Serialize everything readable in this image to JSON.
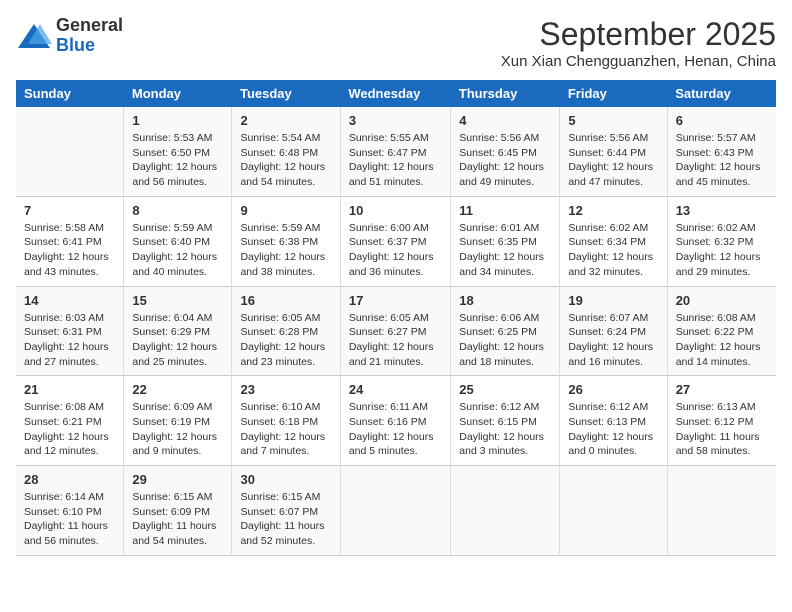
{
  "logo": {
    "line1": "General",
    "line2": "Blue"
  },
  "title": "September 2025",
  "subtitle": "Xun Xian Chengguanzhen, Henan, China",
  "weekdays": [
    "Sunday",
    "Monday",
    "Tuesday",
    "Wednesday",
    "Thursday",
    "Friday",
    "Saturday"
  ],
  "weeks": [
    [
      {
        "day": "",
        "info": ""
      },
      {
        "day": "1",
        "info": "Sunrise: 5:53 AM\nSunset: 6:50 PM\nDaylight: 12 hours\nand 56 minutes."
      },
      {
        "day": "2",
        "info": "Sunrise: 5:54 AM\nSunset: 6:48 PM\nDaylight: 12 hours\nand 54 minutes."
      },
      {
        "day": "3",
        "info": "Sunrise: 5:55 AM\nSunset: 6:47 PM\nDaylight: 12 hours\nand 51 minutes."
      },
      {
        "day": "4",
        "info": "Sunrise: 5:56 AM\nSunset: 6:45 PM\nDaylight: 12 hours\nand 49 minutes."
      },
      {
        "day": "5",
        "info": "Sunrise: 5:56 AM\nSunset: 6:44 PM\nDaylight: 12 hours\nand 47 minutes."
      },
      {
        "day": "6",
        "info": "Sunrise: 5:57 AM\nSunset: 6:43 PM\nDaylight: 12 hours\nand 45 minutes."
      }
    ],
    [
      {
        "day": "7",
        "info": "Sunrise: 5:58 AM\nSunset: 6:41 PM\nDaylight: 12 hours\nand 43 minutes."
      },
      {
        "day": "8",
        "info": "Sunrise: 5:59 AM\nSunset: 6:40 PM\nDaylight: 12 hours\nand 40 minutes."
      },
      {
        "day": "9",
        "info": "Sunrise: 5:59 AM\nSunset: 6:38 PM\nDaylight: 12 hours\nand 38 minutes."
      },
      {
        "day": "10",
        "info": "Sunrise: 6:00 AM\nSunset: 6:37 PM\nDaylight: 12 hours\nand 36 minutes."
      },
      {
        "day": "11",
        "info": "Sunrise: 6:01 AM\nSunset: 6:35 PM\nDaylight: 12 hours\nand 34 minutes."
      },
      {
        "day": "12",
        "info": "Sunrise: 6:02 AM\nSunset: 6:34 PM\nDaylight: 12 hours\nand 32 minutes."
      },
      {
        "day": "13",
        "info": "Sunrise: 6:02 AM\nSunset: 6:32 PM\nDaylight: 12 hours\nand 29 minutes."
      }
    ],
    [
      {
        "day": "14",
        "info": "Sunrise: 6:03 AM\nSunset: 6:31 PM\nDaylight: 12 hours\nand 27 minutes."
      },
      {
        "day": "15",
        "info": "Sunrise: 6:04 AM\nSunset: 6:29 PM\nDaylight: 12 hours\nand 25 minutes."
      },
      {
        "day": "16",
        "info": "Sunrise: 6:05 AM\nSunset: 6:28 PM\nDaylight: 12 hours\nand 23 minutes."
      },
      {
        "day": "17",
        "info": "Sunrise: 6:05 AM\nSunset: 6:27 PM\nDaylight: 12 hours\nand 21 minutes."
      },
      {
        "day": "18",
        "info": "Sunrise: 6:06 AM\nSunset: 6:25 PM\nDaylight: 12 hours\nand 18 minutes."
      },
      {
        "day": "19",
        "info": "Sunrise: 6:07 AM\nSunset: 6:24 PM\nDaylight: 12 hours\nand 16 minutes."
      },
      {
        "day": "20",
        "info": "Sunrise: 6:08 AM\nSunset: 6:22 PM\nDaylight: 12 hours\nand 14 minutes."
      }
    ],
    [
      {
        "day": "21",
        "info": "Sunrise: 6:08 AM\nSunset: 6:21 PM\nDaylight: 12 hours\nand 12 minutes."
      },
      {
        "day": "22",
        "info": "Sunrise: 6:09 AM\nSunset: 6:19 PM\nDaylight: 12 hours\nand 9 minutes."
      },
      {
        "day": "23",
        "info": "Sunrise: 6:10 AM\nSunset: 6:18 PM\nDaylight: 12 hours\nand 7 minutes."
      },
      {
        "day": "24",
        "info": "Sunrise: 6:11 AM\nSunset: 6:16 PM\nDaylight: 12 hours\nand 5 minutes."
      },
      {
        "day": "25",
        "info": "Sunrise: 6:12 AM\nSunset: 6:15 PM\nDaylight: 12 hours\nand 3 minutes."
      },
      {
        "day": "26",
        "info": "Sunrise: 6:12 AM\nSunset: 6:13 PM\nDaylight: 12 hours\nand 0 minutes."
      },
      {
        "day": "27",
        "info": "Sunrise: 6:13 AM\nSunset: 6:12 PM\nDaylight: 11 hours\nand 58 minutes."
      }
    ],
    [
      {
        "day": "28",
        "info": "Sunrise: 6:14 AM\nSunset: 6:10 PM\nDaylight: 11 hours\nand 56 minutes."
      },
      {
        "day": "29",
        "info": "Sunrise: 6:15 AM\nSunset: 6:09 PM\nDaylight: 11 hours\nand 54 minutes."
      },
      {
        "day": "30",
        "info": "Sunrise: 6:15 AM\nSunset: 6:07 PM\nDaylight: 11 hours\nand 52 minutes."
      },
      {
        "day": "",
        "info": ""
      },
      {
        "day": "",
        "info": ""
      },
      {
        "day": "",
        "info": ""
      },
      {
        "day": "",
        "info": ""
      }
    ]
  ]
}
